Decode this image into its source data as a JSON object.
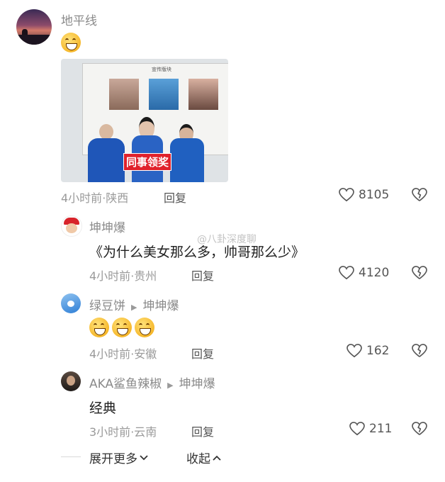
{
  "comment1": {
    "author": "地平线",
    "image_overlay_text": "同事领奖",
    "slide_title": "宣传版块",
    "time": "4小时前",
    "location": "陕西",
    "reply": "回复",
    "likes": "8105"
  },
  "reply1": {
    "author": "坤坤爆",
    "text": "《为什么美女那么多，帅哥那么少》",
    "time": "4小时前",
    "location": "贵州",
    "reply": "回复",
    "likes": "4120",
    "watermark": "@八卦深度聊"
  },
  "reply2": {
    "author": "绿豆饼",
    "reply_to": "坤坤爆",
    "time": "4小时前",
    "location": "安徽",
    "reply": "回复",
    "likes": "162"
  },
  "reply3": {
    "author": "AKA鲨鱼辣椒",
    "reply_to": "坤坤爆",
    "text": "经典",
    "time": "3小时前",
    "location": "云南",
    "reply": "回复",
    "likes": "211"
  },
  "footer": {
    "expand": "展开更多",
    "collapse": "收起"
  }
}
